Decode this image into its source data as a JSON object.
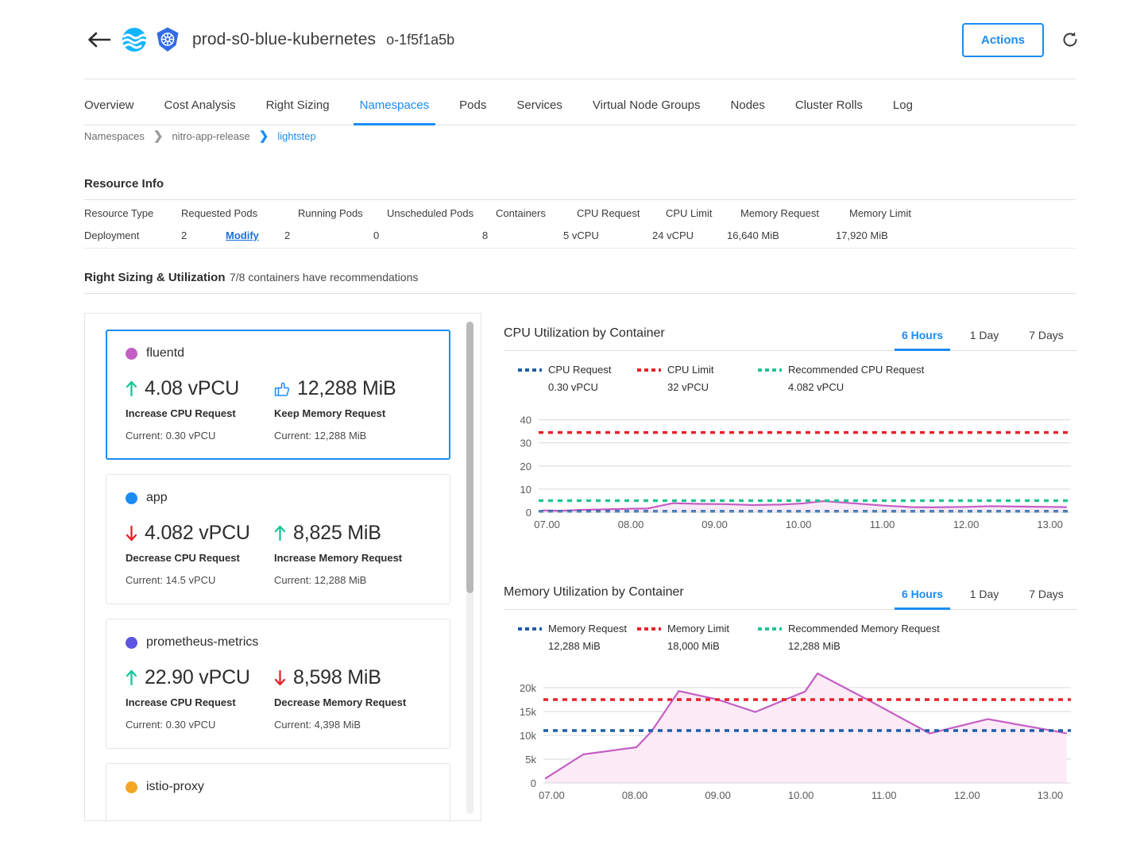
{
  "header": {
    "back_icon": "back-arrow-icon",
    "wave_logo": "ocean-wave-logo-icon",
    "k8s_logo": "kubernetes-logo-icon",
    "cluster_name": "prod-s0-blue-kubernetes",
    "cluster_id": "o-1f5f1a5b",
    "actions_label": "Actions",
    "refresh_icon": "refresh-icon",
    "accent_color": "#1b8cf3"
  },
  "tabs": [
    {
      "label": "Overview",
      "active": false
    },
    {
      "label": "Cost Analysis",
      "active": false
    },
    {
      "label": "Right Sizing",
      "active": false
    },
    {
      "label": "Namespaces",
      "active": true
    },
    {
      "label": "Pods",
      "active": false
    },
    {
      "label": "Services",
      "active": false
    },
    {
      "label": "Virtual Node Groups",
      "active": false
    },
    {
      "label": "Nodes",
      "active": false
    },
    {
      "label": "Cluster Rolls",
      "active": false
    },
    {
      "label": "Log",
      "active": false
    }
  ],
  "breadcrumb": [
    {
      "label": "Namespaces",
      "link": false
    },
    {
      "label": "nitro-app-release",
      "link": false
    },
    {
      "label": "lightstep",
      "link": true
    }
  ],
  "resource_info": {
    "title": "Resource Info",
    "columns": [
      "Resource Type",
      "Requested Pods",
      "",
      "Running Pods",
      "Unscheduled Pods",
      "Containers",
      "CPU Request",
      "CPU Limit",
      "Memory Request",
      "Memory Limit"
    ],
    "values": [
      "Deployment",
      "2",
      "Modify",
      "2",
      "0",
      "8",
      "5 vCPU",
      "24 vCPU",
      "16,640 MiB",
      "17,920 MiB"
    ],
    "modify_label": "Modify"
  },
  "right_sizing": {
    "title": "Right Sizing & Utilization",
    "subtitle": "7/8 containers have recommendations"
  },
  "containers": [
    {
      "name": "fluentd",
      "dot_color": "#c45ec4",
      "selected": true,
      "cpu": {
        "icon": "arrow-up-icon",
        "direction": "up",
        "value": "4.08 vPCU",
        "label": "Increase CPU Request",
        "current": "Current: 0.30 vPCU"
      },
      "memory": {
        "icon": "thumbs-up-icon",
        "direction": "keep",
        "value": "12,288 MiB",
        "label": "Keep Memory Request",
        "current": "Current: 12,288 MiB"
      }
    },
    {
      "name": "app",
      "dot_color": "#1b8cf3",
      "selected": false,
      "cpu": {
        "icon": "arrow-down-icon",
        "direction": "down",
        "value": "4.082 vPCU",
        "label": "Decrease CPU Request",
        "current": "Current: 14.5 vPCU"
      },
      "memory": {
        "icon": "arrow-up-icon",
        "direction": "up",
        "value": "8,825 MiB",
        "label": "Increase Memory Request",
        "current": "Current: 12,288 MiB"
      }
    },
    {
      "name": "prometheus-metrics",
      "dot_color": "#5d56e0",
      "selected": false,
      "cpu": {
        "icon": "arrow-up-icon",
        "direction": "up",
        "value": "22.90 vPCU",
        "label": "Increase CPU Request",
        "current": "Current: 0.30 vPCU"
      },
      "memory": {
        "icon": "arrow-down-icon",
        "direction": "down",
        "value": "8,598 MiB",
        "label": "Decrease Memory Request",
        "current": "Current: 4,398 MiB"
      }
    },
    {
      "name": "istio-proxy",
      "dot_color": "#f5a623",
      "selected": false,
      "cpu": null,
      "memory": null
    }
  ],
  "scrollbar": {
    "name": "container-list-scrollbar"
  },
  "range_tabs": [
    {
      "label": "6 Hours",
      "active": true
    },
    {
      "label": "1 Day",
      "active": false
    },
    {
      "label": "7 Days",
      "active": false
    }
  ],
  "chart_data": [
    {
      "id": "cpu",
      "type": "area",
      "title": "CPU Utilization by Container",
      "xlabel": "",
      "ylabel": "",
      "ylim": [
        0,
        44
      ],
      "yticks": [
        0,
        10,
        20,
        30,
        40
      ],
      "yticklabels": [
        "0",
        "10",
        "20",
        "30",
        "40"
      ],
      "xticklabels": [
        "07.00",
        "08.00",
        "09.00",
        "10.00",
        "11.00",
        "12.00",
        "13.00"
      ],
      "grid": true,
      "legend_position": "top-left",
      "legend": [
        {
          "name": "CPU Request",
          "value": "0.30 vPCU",
          "color": "#1c5fa8",
          "style": "dashed"
        },
        {
          "name": "CPU Limit",
          "value": "32 vPCU",
          "color": "#e8222a",
          "style": "dashed"
        },
        {
          "name": "Recommended CPU Request",
          "value": "4.082 vPCU",
          "color": "#22c493",
          "style": "dashed"
        }
      ],
      "reference_lines": [
        {
          "name": "CPU Limit",
          "value": 34.5,
          "color": "#e8222a"
        },
        {
          "name": "Recommended CPU Request",
          "value": 5.0,
          "color": "#22c493"
        },
        {
          "name": "CPU Request",
          "value": 0.3,
          "color": "#1c5fa8"
        }
      ],
      "series": [
        {
          "name": "fluentd",
          "color": "#c45ec4",
          "fill": "#f7eaf8",
          "x": [
            6.95,
            7.15,
            7.4,
            7.75,
            8.0,
            8.2,
            8.5,
            8.8,
            9.1,
            9.45,
            9.8,
            10.05,
            10.3,
            10.6,
            11.0,
            11.35,
            11.6,
            12.0,
            12.3,
            12.7,
            13.0,
            13.2
          ],
          "y": [
            0.8,
            0.6,
            1.0,
            1.3,
            1.5,
            1.6,
            3.9,
            3.6,
            3.5,
            3.1,
            3.3,
            3.8,
            4.8,
            4.0,
            2.9,
            2.2,
            2.1,
            2.3,
            2.6,
            2.4,
            2.3,
            2.2
          ]
        }
      ]
    },
    {
      "id": "memory",
      "type": "area",
      "title": "Memory Utilization by Container",
      "xlabel": "",
      "ylabel": "",
      "ylim": [
        0,
        23500
      ],
      "yticks": [
        0,
        5000,
        10000,
        15000,
        20000
      ],
      "yticklabels": [
        "0",
        "5k",
        "10k",
        "15k",
        "20k"
      ],
      "xticklabels": [
        "07.00",
        "08.00",
        "09.00",
        "10.00",
        "11.00",
        "12.00",
        "13.00"
      ],
      "grid": true,
      "legend_position": "top-left",
      "legend": [
        {
          "name": "Memory Request",
          "value": "12,288 MiB",
          "color": "#1c5fa8",
          "style": "dashed"
        },
        {
          "name": "Memory Limit",
          "value": "18,000 MiB",
          "color": "#e8222a",
          "style": "dashed"
        },
        {
          "name": "Recommended Memory Request",
          "value": "12,288 MiB",
          "color": "#22c493",
          "style": "dashed"
        }
      ],
      "reference_lines": [
        {
          "name": "Memory Limit",
          "value": 17500,
          "color": "#e8222a"
        },
        {
          "name": "Memory Request",
          "value": 11000,
          "color": "#1c5fa8"
        }
      ],
      "series": [
        {
          "name": "fluentd",
          "color": "#c45ec4",
          "fill": "#fceaf7",
          "x": [
            6.92,
            7.38,
            8.02,
            8.2,
            8.53,
            9.0,
            9.45,
            10.05,
            10.2,
            10.8,
            11.55,
            12.25,
            13.05,
            13.2
          ],
          "y": [
            900,
            6000,
            7500,
            10800,
            19300,
            17500,
            14900,
            19200,
            23000,
            17500,
            10400,
            13400,
            10900,
            10400
          ]
        }
      ]
    }
  ]
}
